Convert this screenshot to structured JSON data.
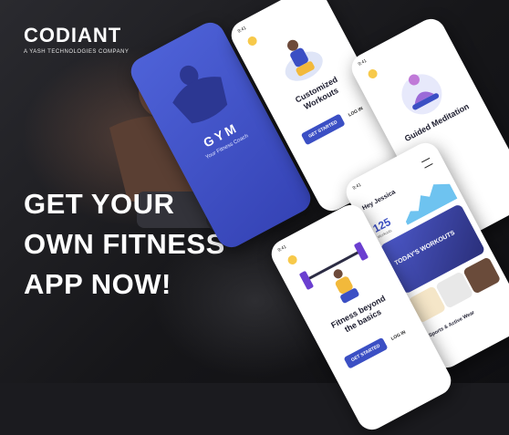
{
  "brand": {
    "name": "CODIANT",
    "tagline": "A YASH TECHNOLOGIES COMPANY"
  },
  "headline": [
    "GET YOUR",
    "OWN FITNESS",
    "APP NOW!"
  ],
  "splash": {
    "app_name": "GYM",
    "subtitle": "Your Fitness Coach"
  },
  "onboarding_1": {
    "time": "9:41",
    "title": "Customized Workouts",
    "cta": "GET STARTED",
    "login": "LOG IN"
  },
  "onboarding_2": {
    "time": "9:41",
    "title": "Guided Meditation"
  },
  "onboarding_3": {
    "time": "9:41",
    "title": "Fitness beyond the basics",
    "cta": "GET STARTED",
    "login": "LOG IN"
  },
  "dashboard": {
    "time": "9:41",
    "greeting": "Hey Jessica",
    "stat_value": "125",
    "stat_label": "Workouts",
    "banner_title": "TODAY'S WORKOUTS",
    "section": "Sports & Active Wear"
  },
  "colors": {
    "accent": "#3b4fc4",
    "splash": "#4457cf"
  }
}
